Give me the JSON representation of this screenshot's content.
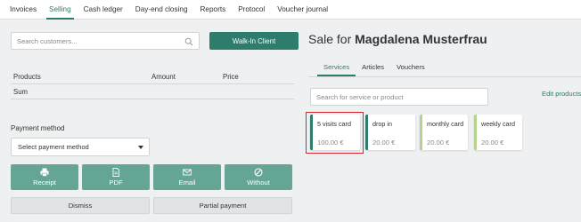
{
  "nav": {
    "items": [
      "Invoices",
      "Selling",
      "Cash ledger",
      "Day-end closing",
      "Reports",
      "Protocol",
      "Voucher journal"
    ],
    "active_index": 1
  },
  "customer": {
    "search_placeholder": "Search customers...",
    "walkin_label": "Walk-In Client"
  },
  "table": {
    "headers": {
      "products": "Products",
      "amount": "Amount",
      "price": "Price"
    },
    "sum_label": "Sum"
  },
  "payment": {
    "label": "Payment method",
    "select_placeholder": "Select payment method",
    "buttons": [
      {
        "label": "Receipt",
        "icon": "printer-icon"
      },
      {
        "label": "PDF",
        "icon": "document-icon"
      },
      {
        "label": "Email",
        "icon": "envelope-icon"
      },
      {
        "label": "Without",
        "icon": "ban-icon"
      }
    ],
    "dismiss_label": "Dismiss",
    "partial_label": "Partial payment"
  },
  "sale": {
    "prefix": "Sale for",
    "customer_name": "Magdalena Musterfrau",
    "tabs": [
      "Services",
      "Articles",
      "Vouchers"
    ],
    "active_tab_index": 0,
    "search_placeholder": "Search for service or product",
    "edit_products_label": "Edit products",
    "services": [
      {
        "name": "5 visits card",
        "price": "100.00 €",
        "selected": true
      },
      {
        "name": "drop in",
        "price": "20.00 €",
        "selected": false
      },
      {
        "name": "monthly card",
        "price": "20.00 €",
        "selected": false
      },
      {
        "name": "weekly card",
        "price": "20.00 €",
        "selected": false
      }
    ]
  },
  "colors": {
    "accent": "#2e7c6c",
    "button": "#65a595",
    "selection": "#d9272e",
    "card_bar_light": "#b7d28c"
  }
}
